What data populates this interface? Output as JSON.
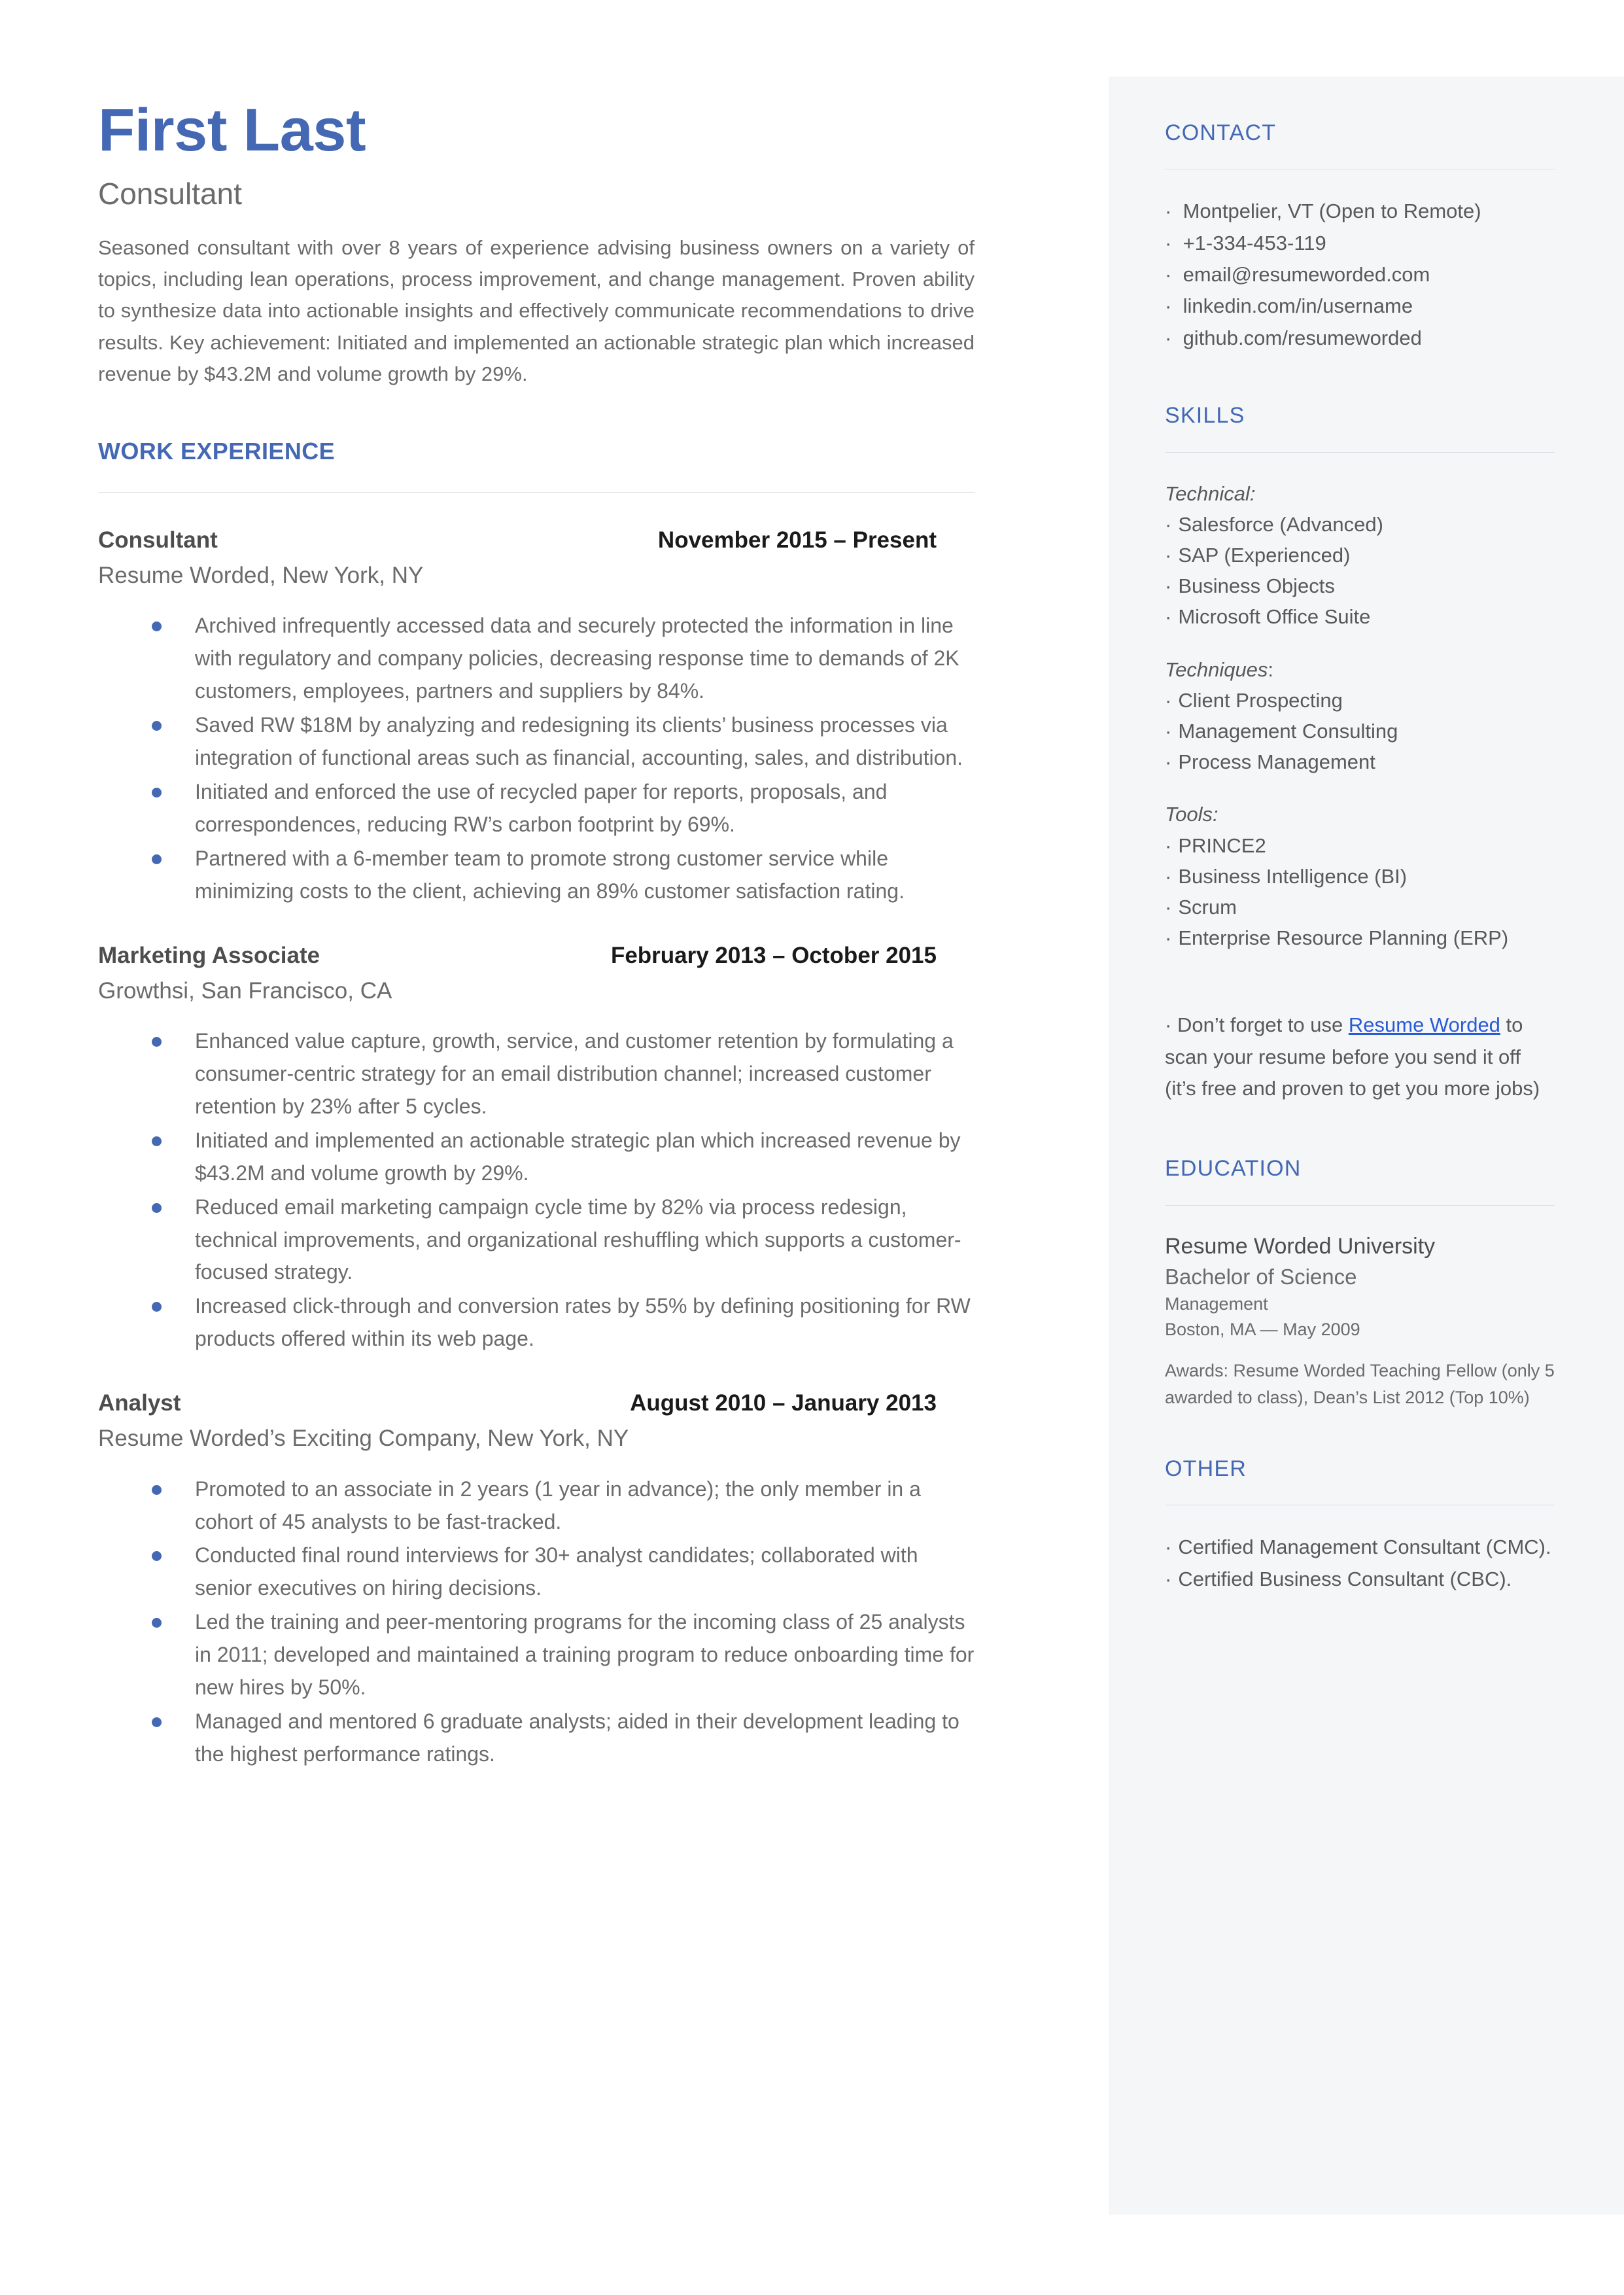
{
  "accent_color": "#4468b4",
  "sidebar_bg": "#f4f6f8",
  "link_color": "#2a5bd7",
  "header": {
    "name": "First Last",
    "role": "Consultant",
    "summary": "Seasoned consultant with over 8 years of experience advising business owners on a variety of topics, including lean operations, process improvement, and change management. Proven ability to synthesize data into actionable insights and effectively communicate recommendations to drive results. Key achievement: Initiated and implemented an actionable strategic plan which increased revenue by $43.2M and volume growth by 29%."
  },
  "work": {
    "heading": "WORK EXPERIENCE",
    "jobs": [
      {
        "title": "Consultant",
        "dates": "November 2015 – Present",
        "company": "Resume Worded, New York, NY",
        "bullets": [
          "Archived infrequently accessed data and securely protected the information in line with regulatory and company policies, decreasing response time to demands of 2K customers, employees, partners and suppliers by 84%.",
          "Saved RW $18M by analyzing and redesigning its clients’ business processes via integration of functional areas such as financial, accounting, sales, and distribution.",
          "Initiated and enforced the use of recycled paper for reports, proposals, and correspondences, reducing RW’s carbon footprint by 69%.",
          "Partnered with a 6-member team to promote strong customer service while minimizing costs to the client, achieving an 89% customer satisfaction rating."
        ]
      },
      {
        "title": "Marketing Associate",
        "dates": "February 2013 – October 2015",
        "company": "Growthsi, San Francisco, CA",
        "bullets": [
          "Enhanced value capture, growth, service, and customer retention by formulating a consumer-centric strategy for an email distribution channel; increased customer retention by 23% after 5 cycles.",
          "Initiated and implemented an actionable strategic plan which increased revenue by $43.2M and volume growth by 29%.",
          "Reduced email marketing campaign cycle time by 82% via process redesign, technical improvements, and organizational reshuffling which supports a customer-focused strategy.",
          "Increased click-through and conversion rates by 55% by defining positioning for RW products offered within its web page."
        ]
      },
      {
        "title": "Analyst",
        "dates": "August 2010 – January 2013",
        "company": "Resume Worded’s Exciting Company, New York, NY",
        "bullets": [
          "Promoted to an associate in 2 years (1 year in advance); the only member in a cohort of 45 analysts to be fast-tracked.",
          "Conducted final round interviews for 30+ analyst candidates; collaborated with senior executives on hiring decisions.",
          "Led the training and peer-mentoring programs for the incoming class of 25 analysts in 2011; developed and maintained a training program to reduce onboarding time for new hires by 50%.",
          "Managed and mentored 6 graduate analysts; aided in their development leading to the highest performance ratings."
        ]
      }
    ]
  },
  "contact": {
    "heading": "CONTACT",
    "items": [
      "Montpelier, VT (Open to Remote)",
      "+1-334-453-119",
      "email@resumeworded.com",
      "linkedin.com/in/username",
      "github.com/resumeworded"
    ]
  },
  "skills": {
    "heading": "SKILLS",
    "groups": [
      {
        "label": "Technical:",
        "label_main": "Technical:",
        "label_tail": "",
        "items": [
          "Salesforce (Advanced)",
          "SAP (Experienced)",
          "Business Objects",
          "Microsoft Office Suite"
        ]
      },
      {
        "label": "Techniques:",
        "label_main": "Techniques",
        "label_tail": ":",
        "items": [
          "Client Prospecting",
          "Management Consulting",
          "Process Management"
        ]
      },
      {
        "label": "Tools:",
        "label_main": "Tools:",
        "label_tail": "",
        "items": [
          "PRINCE2",
          "Business Intelligence (BI)",
          "Scrum",
          "Enterprise Resource Planning (ERP)"
        ]
      }
    ]
  },
  "promo": {
    "prefix": "Don’t forget to use ",
    "link": "Resume Worded",
    "suffix": " to scan your resume before you send it off (it’s free and proven to get you more jobs)"
  },
  "education": {
    "heading": "EDUCATION",
    "school": "Resume Worded University",
    "degree": "Bachelor of Science",
    "field": "Management",
    "location_date": "Boston, MA — May 2009",
    "awards": "Awards: Resume Worded Teaching Fellow (only 5 awarded to class), Dean’s List 2012 (Top 10%)"
  },
  "other": {
    "heading": "OTHER",
    "items": [
      "Certified Management Consultant (CMC).",
      "Certified Business Consultant (CBC)."
    ]
  },
  "glyphs": {
    "bullet": "·"
  }
}
